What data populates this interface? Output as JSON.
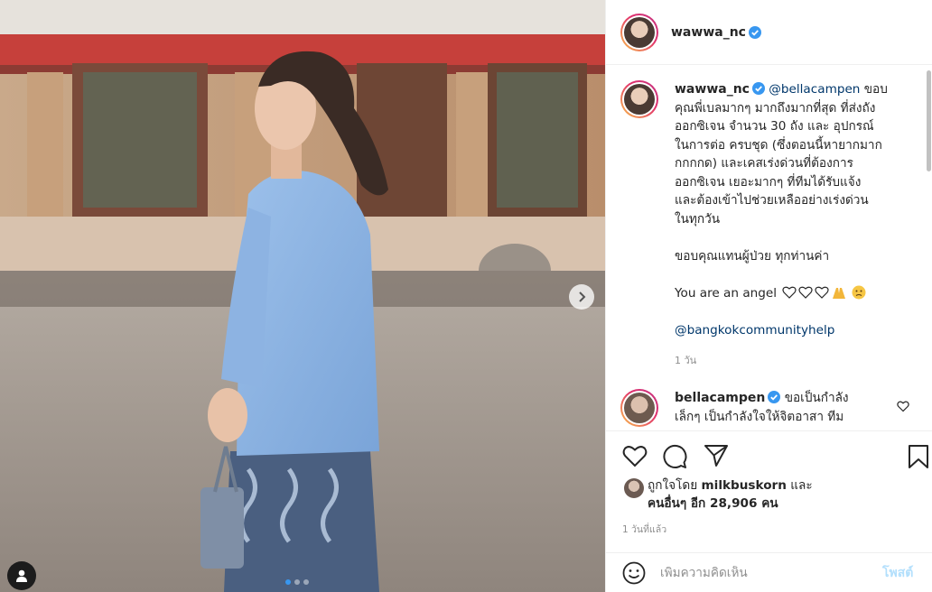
{
  "post": {
    "author": "wawwa_nc",
    "verified": true
  },
  "caption": {
    "author": "wawwa_nc",
    "mention_1": "@bellacampen",
    "line_1_rest": "ขอบ",
    "lines": [
      "คุณพี่เบลมากๆ มากถึงมากที่สุด ที่ส่งถัง",
      "ออกซิเจน จำนวน 30 ถัง และ อุปกรณ์",
      "ในการต่อ ครบชุด (ซึ่งตอนนี้หายากมาก",
      "กกกกด) และเคสเร่งด่วนที่ต้องการ",
      "ออกซิเจน เยอะมากๆ ที่ทีมได้รับแจ้ง",
      "และต้องเข้าไปช่วยเหลืออย่างเร่งด่วน",
      "ในทุกวัน"
    ],
    "thanks": "ขอบคุณแทนผู้ป่วย ทุกท่านค่า",
    "angel": "You are an angel",
    "mention_2": "@bangkokcommunityhelp",
    "time": "1 วัน"
  },
  "comment": {
    "author": "bellacampen",
    "text_1": "ขอเป็นกำลัง",
    "text_2": "เล็กๆ เป็นกำลังใจให้จิตอาสา ทีม"
  },
  "likes": {
    "prefix": "ถูกใจโดย",
    "user": "milkbuskorn",
    "and": "และ",
    "others": "คนอื่นๆ อีก 28,906 คน"
  },
  "post_time": "1 วันที่แล้ว",
  "add_comment": {
    "placeholder": "เพิ่มความคิดเห็น",
    "post_label": "โพสต์"
  },
  "carousel": {
    "count": 3,
    "active": 0
  },
  "colors": {
    "link": "#00376b",
    "verified": "#3897f0",
    "post_button": "#b2dffc"
  }
}
